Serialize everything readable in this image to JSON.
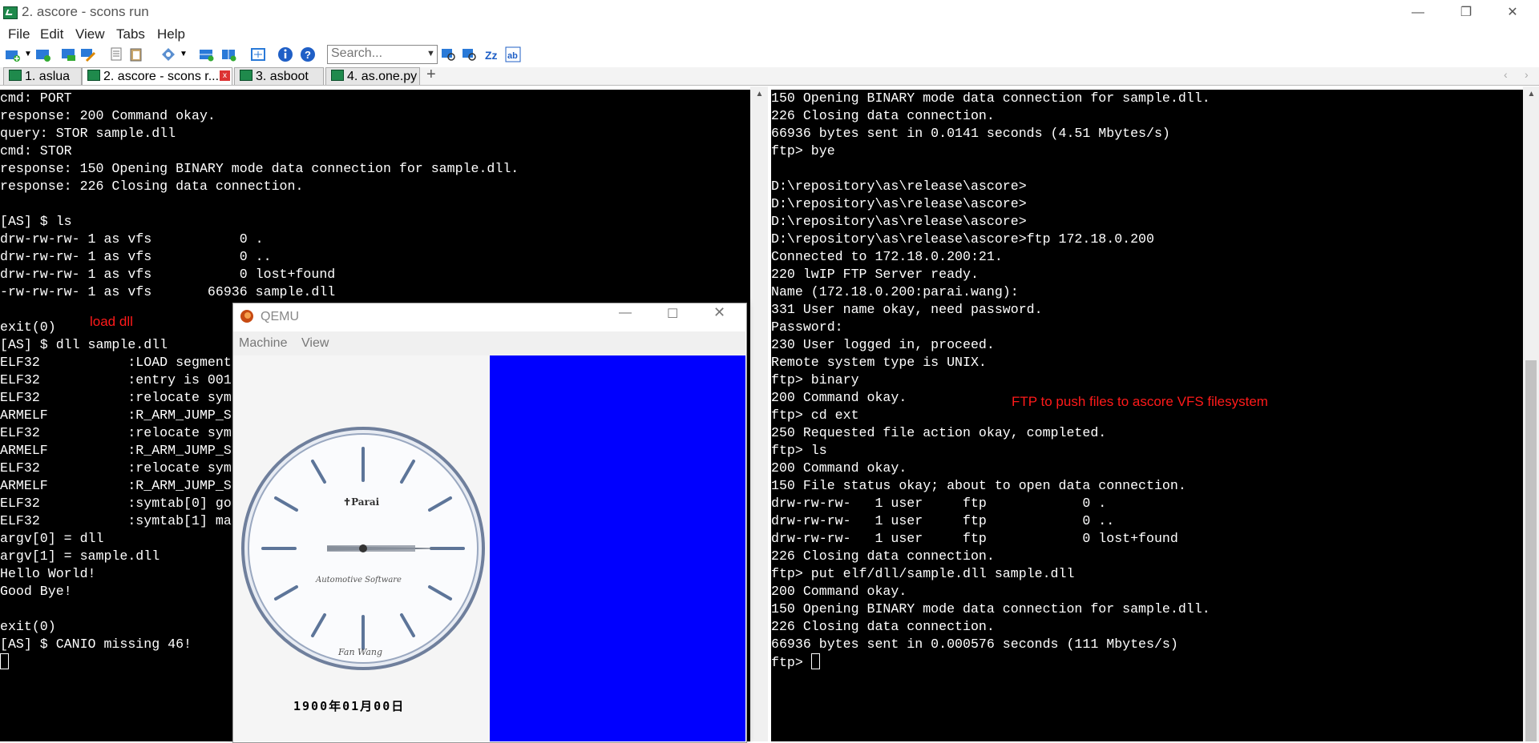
{
  "window": {
    "title": "2. ascore - scons  run",
    "controls": [
      "—",
      "❐",
      "✕"
    ]
  },
  "menu": [
    "File",
    "Edit",
    "View",
    "Tabs",
    "Help"
  ],
  "toolbar": {
    "search_placeholder": "Search..."
  },
  "tabs": [
    {
      "label": "1. aslua",
      "active": false
    },
    {
      "label": "2. ascore - scons  r...",
      "active": true
    },
    {
      "label": "3. asboot",
      "active": false
    },
    {
      "label": "4. as.one.py",
      "active": false
    }
  ],
  "left_terminal": {
    "lines": [
      "cmd: PORT",
      "response: 200 Command okay.",
      "query: STOR sample.dll",
      "cmd: STOR",
      "response: 150 Opening BINARY mode data connection for sample.dll.",
      "response: 226 Closing data connection.",
      "",
      "[AS] $ ls",
      "drw-rw-rw- 1 as vfs           0 .",
      "drw-rw-rw- 1 as vfs           0 ..",
      "drw-rw-rw- 1 as vfs           0 lost+found",
      "-rw-rw-rw- 1 as vfs       66936 sample.dll",
      "",
      "exit(0)",
      "[AS] $ dll sample.dll",
      "ELF32           :LOAD segment",
      "ELF32           :entry is 001",
      "ELF32           :relocate sym",
      "ARMELF          :R_ARM_JUMP_S",
      "ELF32           :relocate sym",
      "ARMELF          :R_ARM_JUMP_S",
      "ELF32           :relocate sym",
      "ARMELF          :R_ARM_JUMP_S",
      "ELF32           :symtab[0] go",
      "ELF32           :symtab[1] ma",
      "argv[0] = dll",
      "argv[1] = sample.dll",
      "Hello World!",
      "Good Bye!",
      "",
      "exit(0)",
      "[AS] $ CANIO missing 46!"
    ],
    "annotation": "load dll"
  },
  "right_terminal": {
    "lines": [
      "150 Opening BINARY mode data connection for sample.dll.",
      "226 Closing data connection.",
      "66936 bytes sent in 0.0141 seconds (4.51 Mbytes/s)",
      "ftp> bye",
      "",
      "D:\\repository\\as\\release\\ascore>",
      "D:\\repository\\as\\release\\ascore>",
      "D:\\repository\\as\\release\\ascore>",
      "D:\\repository\\as\\release\\ascore>ftp 172.18.0.200",
      "Connected to 172.18.0.200:21.",
      "220 lwIP FTP Server ready.",
      "Name (172.18.0.200:parai.wang):",
      "331 User name okay, need password.",
      "Password:",
      "230 User logged in, proceed.",
      "Remote system type is UNIX.",
      "ftp> binary",
      "200 Command okay.",
      "ftp> cd ext",
      "250 Requested file action okay, completed.",
      "ftp> ls",
      "200 Command okay.",
      "150 File status okay; about to open data connection.",
      "drw-rw-rw-   1 user     ftp            0 .",
      "drw-rw-rw-   1 user     ftp            0 ..",
      "drw-rw-rw-   1 user     ftp            0 lost+found",
      "226 Closing data connection.",
      "ftp> put elf/dll/sample.dll sample.dll",
      "200 Command okay.",
      "150 Opening BINARY mode data connection for sample.dll.",
      "226 Closing data connection.",
      "66936 bytes sent in 0.000576 seconds (111 Mbytes/s)",
      "ftp> "
    ],
    "annotation": "FTP to push files to ascore VFS filesystem"
  },
  "qemu": {
    "title": "QEMU",
    "menu": [
      "Machine",
      "View"
    ],
    "clock": {
      "brand": "Parai",
      "subtitle": "Automotive Software",
      "author": "Fan Wang",
      "date": "1900年01月00日"
    },
    "colors": {
      "screen_right": "#0000ff"
    }
  }
}
